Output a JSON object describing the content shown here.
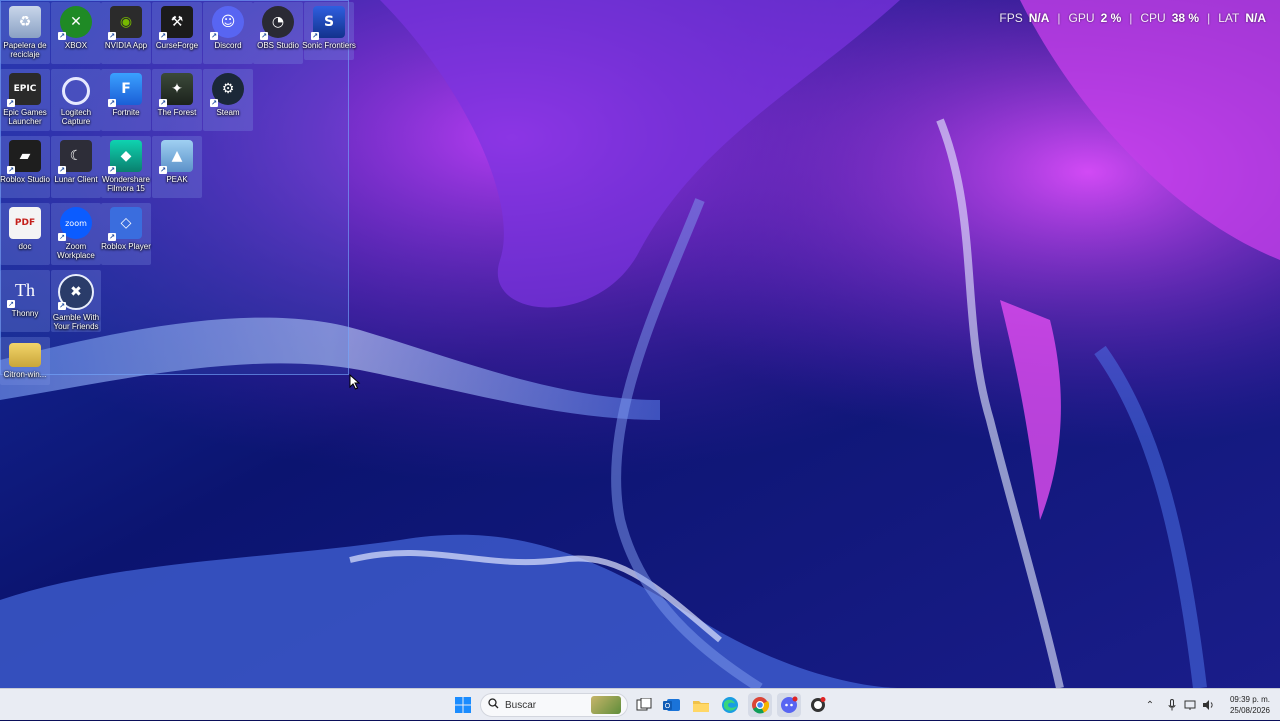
{
  "overlay": {
    "fps_label": "FPS",
    "fps_value": "N/A",
    "gpu_label": "GPU",
    "gpu_value": "2 %",
    "cpu_label": "CPU",
    "cpu_value": "38 %",
    "lat_label": "LAT",
    "lat_value": "N/A"
  },
  "desktop_icons": [
    {
      "label": "Papelera de reciclaje",
      "icon": "recycle-bin-icon"
    },
    {
      "label": "XBOX",
      "icon": "xbox-icon"
    },
    {
      "label": "NVIDIA App",
      "icon": "nvidia-icon"
    },
    {
      "label": "CurseForge",
      "icon": "curseforge-icon"
    },
    {
      "label": "Discord",
      "icon": "discord-icon"
    },
    {
      "label": "OBS Studio",
      "icon": "obs-icon"
    },
    {
      "label": "Sonic Frontiers",
      "icon": "sonic-icon"
    },
    {
      "label": "Epic Games Launcher",
      "icon": "epic-games-icon"
    },
    {
      "label": "Logitech Capture",
      "icon": "logitech-icon"
    },
    {
      "label": "Fortnite",
      "icon": "fortnite-icon"
    },
    {
      "label": "The Forest",
      "icon": "the-forest-icon"
    },
    {
      "label": "Steam",
      "icon": "steam-icon"
    },
    {
      "label": "Roblox Studio",
      "icon": "roblox-studio-icon"
    },
    {
      "label": "Lunar Client",
      "icon": "lunar-client-icon"
    },
    {
      "label": "Wondershare Filmora 15",
      "icon": "filmora-icon"
    },
    {
      "label": "PEAK",
      "icon": "peak-icon"
    },
    {
      "label": "doc",
      "icon": "pdf-icon"
    },
    {
      "label": "Zoom Workplace",
      "icon": "zoom-icon"
    },
    {
      "label": "Roblox Player",
      "icon": "roblox-player-icon"
    },
    {
      "label": "Thonny",
      "icon": "thonny-icon"
    },
    {
      "label": "Gamble With Your Friends",
      "icon": "gamble-icon"
    },
    {
      "label": "Citron-win...",
      "icon": "folder-icon"
    }
  ],
  "taskbar": {
    "search_placeholder": "Buscar",
    "pinned": [
      "start-icon",
      "search-icon",
      "task-view-icon",
      "outlook-icon",
      "file-explorer-icon",
      "edge-icon",
      "chrome-icon",
      "discord-icon",
      "app-icon"
    ],
    "clock_time": "09:39 p. m.",
    "clock_date": "25/08/2026"
  },
  "colors": {
    "accent_blue": "#2a62d8",
    "wallpaper_purple": "#8a2be2",
    "taskbar_bg": "#e9ecf3"
  }
}
